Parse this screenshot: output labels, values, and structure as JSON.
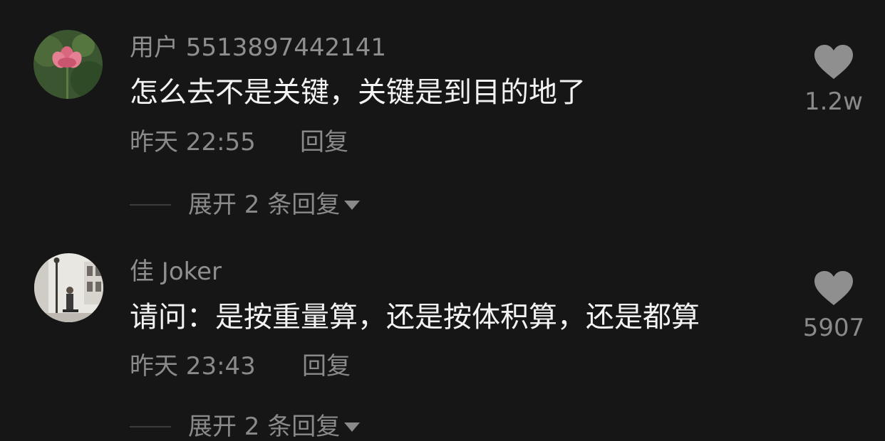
{
  "comments": [
    {
      "username": "用户 5513897442141",
      "text": "怎么去不是关键，关键是到目的地了",
      "time": "昨天 22:55",
      "reply_label": "回复",
      "expand_label": "展开 2 条回复",
      "likes": "1.2w",
      "avatar_icon": "lotus-flower-avatar"
    },
    {
      "username": "佳 Joker",
      "text": "请问：是按重量算，还是按体积算，还是都算",
      "time": "昨天 23:43",
      "reply_label": "回复",
      "expand_label": "展开 2 条回复",
      "likes": "5907",
      "avatar_icon": "street-photo-avatar"
    }
  ],
  "colors": {
    "background": "#161616",
    "primary_text": "#f2f2f2",
    "secondary_text": "#8a8a8a",
    "heart": "#8f8f8f"
  }
}
